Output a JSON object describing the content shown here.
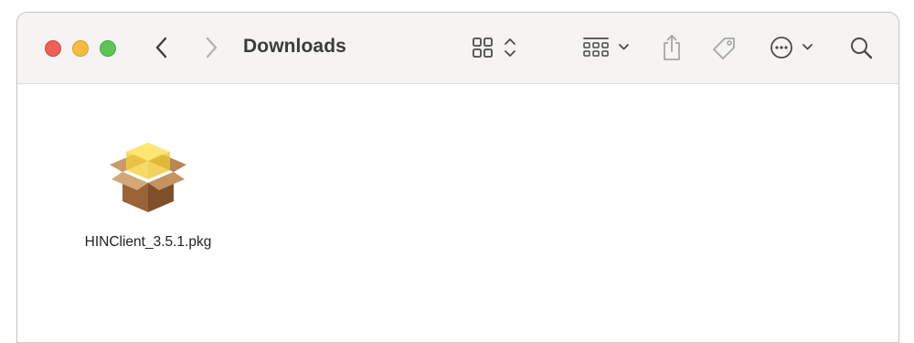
{
  "window": {
    "title": "Downloads"
  },
  "toolbar": {
    "back_icon": "chevron-left-icon",
    "forward_icon": "chevron-right-icon",
    "view_icon": "icon-grid-view-icon",
    "group_icon": "group-by-icon",
    "share_icon": "share-icon",
    "tag_icon": "tag-icon",
    "more_icon": "ellipsis-circle-icon",
    "search_icon": "search-icon"
  },
  "files": [
    {
      "name": "HINClient_3.5.1.pkg",
      "icon": "package-icon"
    }
  ],
  "colors": {
    "close": "#ee5f57",
    "minimize": "#f4bd3f",
    "zoom": "#5fc453",
    "toolbar_bg": "#f5f4f3"
  }
}
